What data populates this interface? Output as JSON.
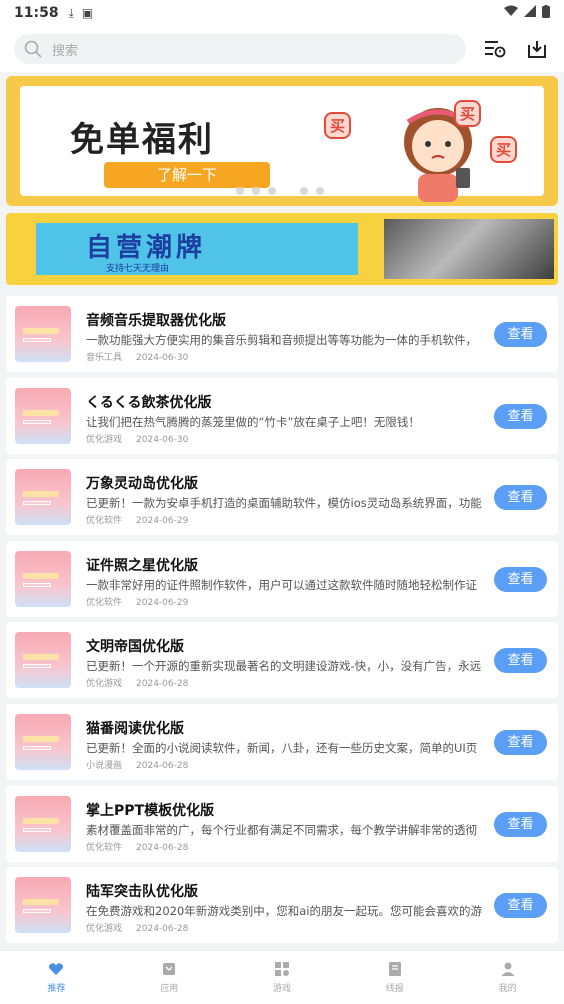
{
  "status_bar": {
    "time": "11:58"
  },
  "search": {
    "placeholder": "搜索"
  },
  "banner": {
    "title": "免单福利",
    "cta": "了解一下",
    "stickers": [
      "买",
      "买",
      "买"
    ],
    "dot_count": 6,
    "active_dot": 3
  },
  "banner2": {
    "title": "自营潮牌",
    "subtitle": "支持七天无理由"
  },
  "apps": [
    {
      "name": "音频音乐提取器优化版",
      "desc": "一款功能强大方便实用的集音乐剪辑和音频提出等等功能为一体的手机软件，",
      "category": "音乐工具",
      "date": "2024-06-30",
      "button": "查看"
    },
    {
      "name": "くるくる飲茶优化版",
      "desc": "让我们把在热气腾腾的蒸笼里做的“竹卡”放在桌子上吧！无限钱！",
      "category": "优化游戏",
      "date": "2024-06-30",
      "button": "查看"
    },
    {
      "name": "万象灵动岛优化版",
      "desc": "已更新！一款为安卓手机打造的桌面辅助软件，模仿ios灵动岛系统界面，功能",
      "category": "优化软件",
      "date": "2024-06-29",
      "button": "查看"
    },
    {
      "name": "证件照之星优化版",
      "desc": "一款非常好用的证件照制作软件，用户可以通过这款软件随时随地轻松制作证",
      "category": "优化软件",
      "date": "2024-06-29",
      "button": "查看"
    },
    {
      "name": "文明帝国优化版",
      "desc": "已更新！一个开源的重新实现最著名的文明建设游戏-快，小，没有广告，永远",
      "category": "优化游戏",
      "date": "2024-06-28",
      "button": "查看"
    },
    {
      "name": "猫番阅读优化版",
      "desc": "已更新！全面的小说阅读软件，新闻，八卦，还有一些历史文案，简单的UI页",
      "category": "小说漫画",
      "date": "2024-06-28",
      "button": "查看"
    },
    {
      "name": "掌上PPT模板优化版",
      "desc": "素材覆盖面非常的广，每个行业都有满足不同需求，每个教学讲解非常的透彻",
      "category": "优化软件",
      "date": "2024-06-28",
      "button": "查看"
    },
    {
      "name": "陆军突击队优化版",
      "desc": "在免费游戏和2020年新游戏类别中，您和ai的朋友一起玩。您可能会喜欢的游",
      "category": "优化游戏",
      "date": "2024-06-28",
      "button": "查看"
    }
  ],
  "tabs": [
    {
      "label": "推荐",
      "icon": "heart-icon",
      "active": true
    },
    {
      "label": "应用",
      "icon": "app-icon",
      "active": false
    },
    {
      "label": "游戏",
      "icon": "grid-icon",
      "active": false
    },
    {
      "label": "线报",
      "icon": "news-icon",
      "active": false
    },
    {
      "label": "我的",
      "icon": "user-icon",
      "active": false
    }
  ],
  "colors": {
    "accent": "#5b9ef6",
    "tab_active": "#4a90e2",
    "banner_bg": "#f7c948"
  }
}
